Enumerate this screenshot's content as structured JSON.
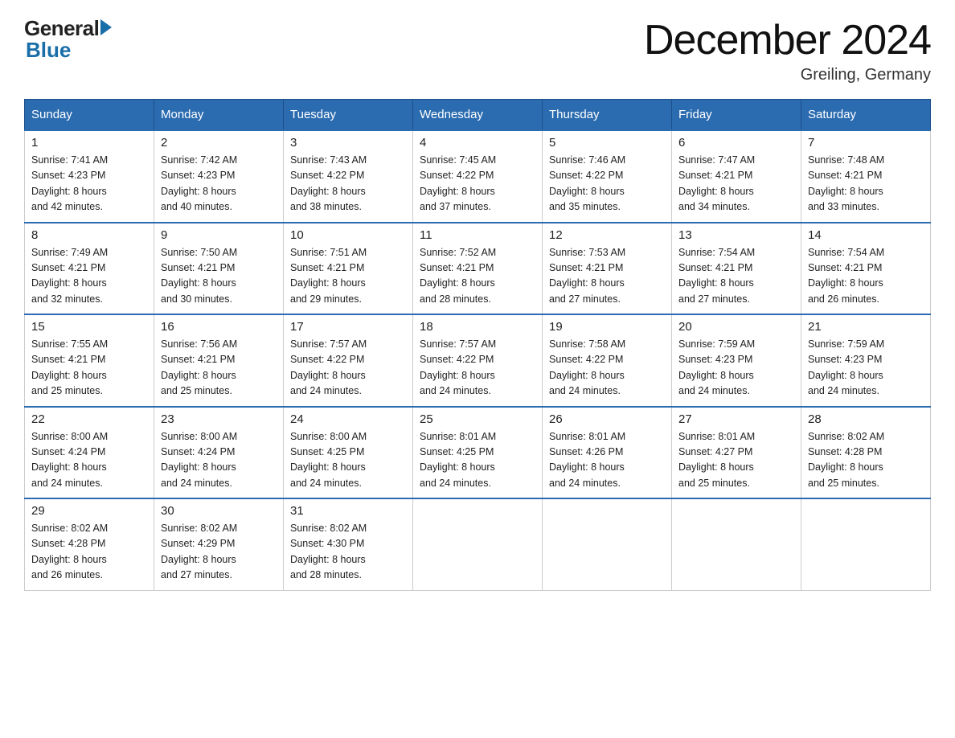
{
  "header": {
    "logo_general": "General",
    "logo_blue": "Blue",
    "month_title": "December 2024",
    "location": "Greiling, Germany"
  },
  "weekdays": [
    "Sunday",
    "Monday",
    "Tuesday",
    "Wednesday",
    "Thursday",
    "Friday",
    "Saturday"
  ],
  "weeks": [
    [
      {
        "day": "1",
        "sunrise": "7:41 AM",
        "sunset": "4:23 PM",
        "daylight": "8 hours and 42 minutes."
      },
      {
        "day": "2",
        "sunrise": "7:42 AM",
        "sunset": "4:23 PM",
        "daylight": "8 hours and 40 minutes."
      },
      {
        "day": "3",
        "sunrise": "7:43 AM",
        "sunset": "4:22 PM",
        "daylight": "8 hours and 38 minutes."
      },
      {
        "day": "4",
        "sunrise": "7:45 AM",
        "sunset": "4:22 PM",
        "daylight": "8 hours and 37 minutes."
      },
      {
        "day": "5",
        "sunrise": "7:46 AM",
        "sunset": "4:22 PM",
        "daylight": "8 hours and 35 minutes."
      },
      {
        "day": "6",
        "sunrise": "7:47 AM",
        "sunset": "4:21 PM",
        "daylight": "8 hours and 34 minutes."
      },
      {
        "day": "7",
        "sunrise": "7:48 AM",
        "sunset": "4:21 PM",
        "daylight": "8 hours and 33 minutes."
      }
    ],
    [
      {
        "day": "8",
        "sunrise": "7:49 AM",
        "sunset": "4:21 PM",
        "daylight": "8 hours and 32 minutes."
      },
      {
        "day": "9",
        "sunrise": "7:50 AM",
        "sunset": "4:21 PM",
        "daylight": "8 hours and 30 minutes."
      },
      {
        "day": "10",
        "sunrise": "7:51 AM",
        "sunset": "4:21 PM",
        "daylight": "8 hours and 29 minutes."
      },
      {
        "day": "11",
        "sunrise": "7:52 AM",
        "sunset": "4:21 PM",
        "daylight": "8 hours and 28 minutes."
      },
      {
        "day": "12",
        "sunrise": "7:53 AM",
        "sunset": "4:21 PM",
        "daylight": "8 hours and 27 minutes."
      },
      {
        "day": "13",
        "sunrise": "7:54 AM",
        "sunset": "4:21 PM",
        "daylight": "8 hours and 27 minutes."
      },
      {
        "day": "14",
        "sunrise": "7:54 AM",
        "sunset": "4:21 PM",
        "daylight": "8 hours and 26 minutes."
      }
    ],
    [
      {
        "day": "15",
        "sunrise": "7:55 AM",
        "sunset": "4:21 PM",
        "daylight": "8 hours and 25 minutes."
      },
      {
        "day": "16",
        "sunrise": "7:56 AM",
        "sunset": "4:21 PM",
        "daylight": "8 hours and 25 minutes."
      },
      {
        "day": "17",
        "sunrise": "7:57 AM",
        "sunset": "4:22 PM",
        "daylight": "8 hours and 24 minutes."
      },
      {
        "day": "18",
        "sunrise": "7:57 AM",
        "sunset": "4:22 PM",
        "daylight": "8 hours and 24 minutes."
      },
      {
        "day": "19",
        "sunrise": "7:58 AM",
        "sunset": "4:22 PM",
        "daylight": "8 hours and 24 minutes."
      },
      {
        "day": "20",
        "sunrise": "7:59 AM",
        "sunset": "4:23 PM",
        "daylight": "8 hours and 24 minutes."
      },
      {
        "day": "21",
        "sunrise": "7:59 AM",
        "sunset": "4:23 PM",
        "daylight": "8 hours and 24 minutes."
      }
    ],
    [
      {
        "day": "22",
        "sunrise": "8:00 AM",
        "sunset": "4:24 PM",
        "daylight": "8 hours and 24 minutes."
      },
      {
        "day": "23",
        "sunrise": "8:00 AM",
        "sunset": "4:24 PM",
        "daylight": "8 hours and 24 minutes."
      },
      {
        "day": "24",
        "sunrise": "8:00 AM",
        "sunset": "4:25 PM",
        "daylight": "8 hours and 24 minutes."
      },
      {
        "day": "25",
        "sunrise": "8:01 AM",
        "sunset": "4:25 PM",
        "daylight": "8 hours and 24 minutes."
      },
      {
        "day": "26",
        "sunrise": "8:01 AM",
        "sunset": "4:26 PM",
        "daylight": "8 hours and 24 minutes."
      },
      {
        "day": "27",
        "sunrise": "8:01 AM",
        "sunset": "4:27 PM",
        "daylight": "8 hours and 25 minutes."
      },
      {
        "day": "28",
        "sunrise": "8:02 AM",
        "sunset": "4:28 PM",
        "daylight": "8 hours and 25 minutes."
      }
    ],
    [
      {
        "day": "29",
        "sunrise": "8:02 AM",
        "sunset": "4:28 PM",
        "daylight": "8 hours and 26 minutes."
      },
      {
        "day": "30",
        "sunrise": "8:02 AM",
        "sunset": "4:29 PM",
        "daylight": "8 hours and 27 minutes."
      },
      {
        "day": "31",
        "sunrise": "8:02 AM",
        "sunset": "4:30 PM",
        "daylight": "8 hours and 28 minutes."
      },
      null,
      null,
      null,
      null
    ]
  ]
}
